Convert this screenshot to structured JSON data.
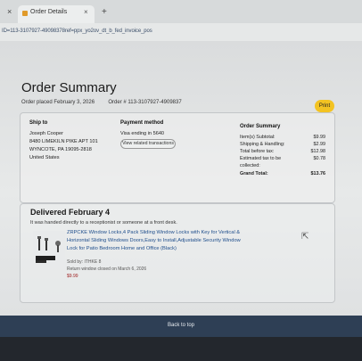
{
  "browser": {
    "tab_title": "Order Details",
    "tab_close": "×",
    "left_close": "×",
    "new_tab": "+",
    "url": "ID=113-3107927-49098378ref=ppx_yo2ov_dt_b_fed_invoice_pos"
  },
  "header": {
    "title": "Order Summary",
    "order_placed": "Order placed February 3, 2026",
    "order_number": "Order # 113-3107927-4909837",
    "print_label": "Print"
  },
  "ship_to": {
    "heading": "Ship to",
    "lines": [
      "Joseph Cooper",
      "8480 LIMEKILN PIKE APT 101",
      "WYNCOTE, PA 19095-2818",
      "United States"
    ]
  },
  "payment": {
    "heading": "Payment method",
    "method": "Visa ending in 5640",
    "view_transactions": "View related transactions"
  },
  "summary": {
    "heading": "Order Summary",
    "rows": [
      {
        "label": "Item(s) Subtotal:",
        "value": "$9.99"
      },
      {
        "label": "Shipping & Handling:",
        "value": "$2.99"
      },
      {
        "label": "Total before tax:",
        "value": "$12.98"
      },
      {
        "label": "Estimated tax to be",
        "value": "$0.78"
      },
      {
        "label": "collected:",
        "value": ""
      }
    ],
    "grand_total_label": "Grand Total:",
    "grand_total_value": "$13.76"
  },
  "delivery": {
    "heading": "Delivered February 4",
    "note": "It was handed directly to a receptionist or someone at a front desk.",
    "product_title": "ZRPCKE Window Locks,4 Pack Sliding Window Locks with Key for Vertical & Horizontal Sliding Windows Doors,Easy to Install,Adjustable Security Window Lock for Patio Bedroom Home and Office (Black)",
    "sold_by": "Sold by: ITHKE 8",
    "return_note": "Return window closed on March 6, 2026",
    "price": "$9.99"
  },
  "footer": {
    "back_to_top": "Back to top"
  }
}
